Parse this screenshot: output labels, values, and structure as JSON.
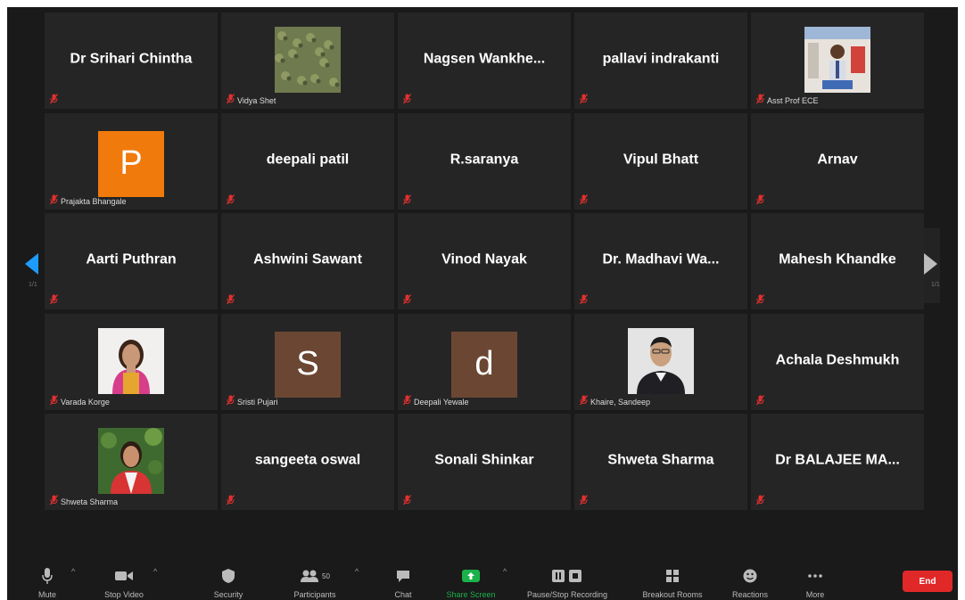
{
  "pagination": {
    "left": "1/1",
    "right": "1/1"
  },
  "tiles": [
    {
      "name": "Dr Srihari Chintha",
      "type": "name",
      "label": ""
    },
    {
      "name": "",
      "type": "photo",
      "photo": "texture",
      "label": "Vidya Shet"
    },
    {
      "name": "Nagsen  Wankhe...",
      "type": "name",
      "label": ""
    },
    {
      "name": "pallavi indrakanti",
      "type": "name",
      "label": ""
    },
    {
      "name": "",
      "type": "photo",
      "photo": "presenter",
      "label": "Asst Prof ECE"
    },
    {
      "name": "P",
      "type": "avatar",
      "color": "#f07a0c",
      "label": "Prajakta Bhangale"
    },
    {
      "name": "deepali patil",
      "type": "name",
      "label": ""
    },
    {
      "name": "R.saranya",
      "type": "name",
      "label": ""
    },
    {
      "name": "Vipul Bhatt",
      "type": "name",
      "label": ""
    },
    {
      "name": "Arnav",
      "type": "name",
      "label": ""
    },
    {
      "name": "Aarti Puthran",
      "type": "name",
      "label": ""
    },
    {
      "name": "Ashwini Sawant",
      "type": "name",
      "label": ""
    },
    {
      "name": "Vinod Nayak",
      "type": "name",
      "label": ""
    },
    {
      "name": "Dr.  Madhavi Wa...",
      "type": "name",
      "label": ""
    },
    {
      "name": "Mahesh Khandke",
      "type": "name",
      "label": ""
    },
    {
      "name": "",
      "type": "photo",
      "photo": "woman",
      "label": "Varada Korge"
    },
    {
      "name": "S",
      "type": "avatar",
      "color": "#6b4733",
      "label": "Sristi Pujari"
    },
    {
      "name": "d",
      "type": "avatar",
      "color": "#6b4733",
      "label": "Deepali Yewale"
    },
    {
      "name": "",
      "type": "photo",
      "photo": "man",
      "label": "Khaire, Sandeep"
    },
    {
      "name": "Achala Deshmukh",
      "type": "name",
      "label": ""
    },
    {
      "name": "",
      "type": "photo",
      "photo": "woman2",
      "label": "Shweta Sharma"
    },
    {
      "name": "sangeeta oswal",
      "type": "name",
      "label": ""
    },
    {
      "name": "Sonali Shinkar",
      "type": "name",
      "label": ""
    },
    {
      "name": "Shweta Sharma",
      "type": "name",
      "label": ""
    },
    {
      "name": "Dr BALAJEE  MA...",
      "type": "name",
      "label": ""
    }
  ],
  "toolbar": {
    "mute": "Mute",
    "stop_video": "Stop Video",
    "security": "Security",
    "participants": "Participants",
    "participant_count": "50",
    "chat": "Chat",
    "share_screen": "Share Screen",
    "pause_recording": "Pause/Stop Recording",
    "breakout_rooms": "Breakout Rooms",
    "reactions": "Reactions",
    "more": "More",
    "end": "End"
  },
  "colors": {
    "share_green": "#1bb24a",
    "end_red": "#e02828",
    "muted_red": "#e0302f",
    "arrow_blue": "#1e9bff"
  }
}
